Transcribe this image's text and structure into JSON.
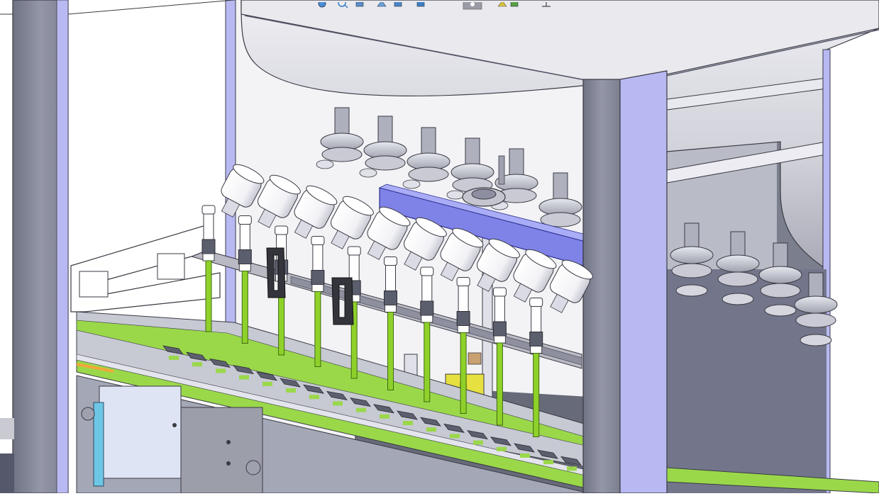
{
  "viewport": {
    "background": "#ffffff",
    "colors": {
      "frame": "#8f93a3",
      "frame_light": "#b8b9f2",
      "frame_dark": "#6d7080",
      "tank": "#c9cad2",
      "tank_light": "#ecedf2",
      "nozzle_green": "#8fd12a",
      "manifold_blue": "#7f83e8",
      "conveyor_green": "#9ad84a",
      "yellow_bracket": "#e6e040",
      "valve_body": "#ffffff",
      "clamp_gray": "#b9bac4"
    }
  },
  "toolbar": {
    "icons": [
      "hide-show-icon",
      "zoom-icon",
      "section-view-icon",
      "view-orientation-icon",
      "display-style-icon",
      "appearance-icon",
      "scene-icon",
      "render-tools-icon",
      "settings-icon"
    ]
  },
  "model": {
    "nozzle_count": 10,
    "valve_count": 10
  }
}
